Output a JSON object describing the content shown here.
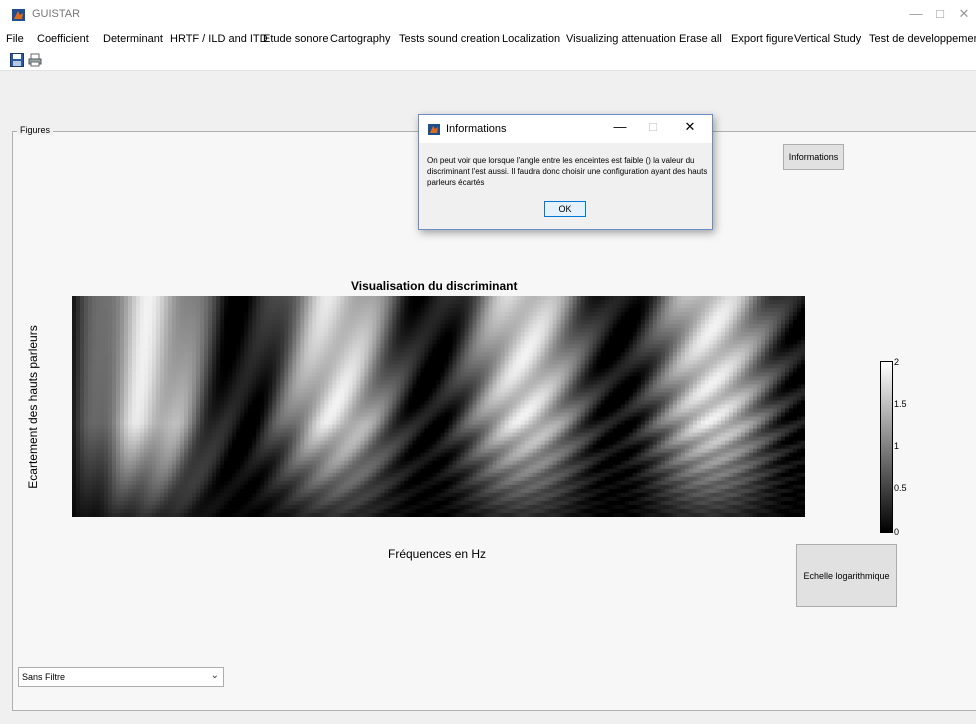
{
  "window": {
    "title": "GUISTAR"
  },
  "menu": [
    "File",
    "Coefficient",
    "Determinant",
    "HRTF / ILD and ITD",
    "Etude sonore",
    "Cartography",
    "Tests sound creation",
    "Localization",
    "Visualizing attenuation",
    "Erase all",
    "Export figure",
    "Vertical Study",
    "Test de developpement"
  ],
  "toolbar": {
    "icons": [
      "save-icon",
      "print-icon"
    ]
  },
  "panel": {
    "title": "Figures"
  },
  "buttons": {
    "informations": "Informations",
    "log_scale": "Echelle logarithmique"
  },
  "filter": {
    "selected": "Sans Filtre"
  },
  "dialog": {
    "title": "Informations",
    "message": "On peut voir que lorsque l'angle entre les enceintes est faible () la valeur du discriminant l'est aussi. Il faudra donc choisir une configuration ayant des hauts parleurs écartés",
    "ok_label": "OK"
  },
  "chart_data": {
    "type": "heatmap",
    "title": "Visualisation du discriminant",
    "xlabel": "Fréquences en Hz",
    "ylabel": "Ecartement des hauts parleurs",
    "colormap": "gray",
    "colorbar": {
      "min": 0,
      "max": 2,
      "ticks": [
        "2",
        "1.5",
        "1",
        "0.5",
        "0"
      ]
    }
  }
}
